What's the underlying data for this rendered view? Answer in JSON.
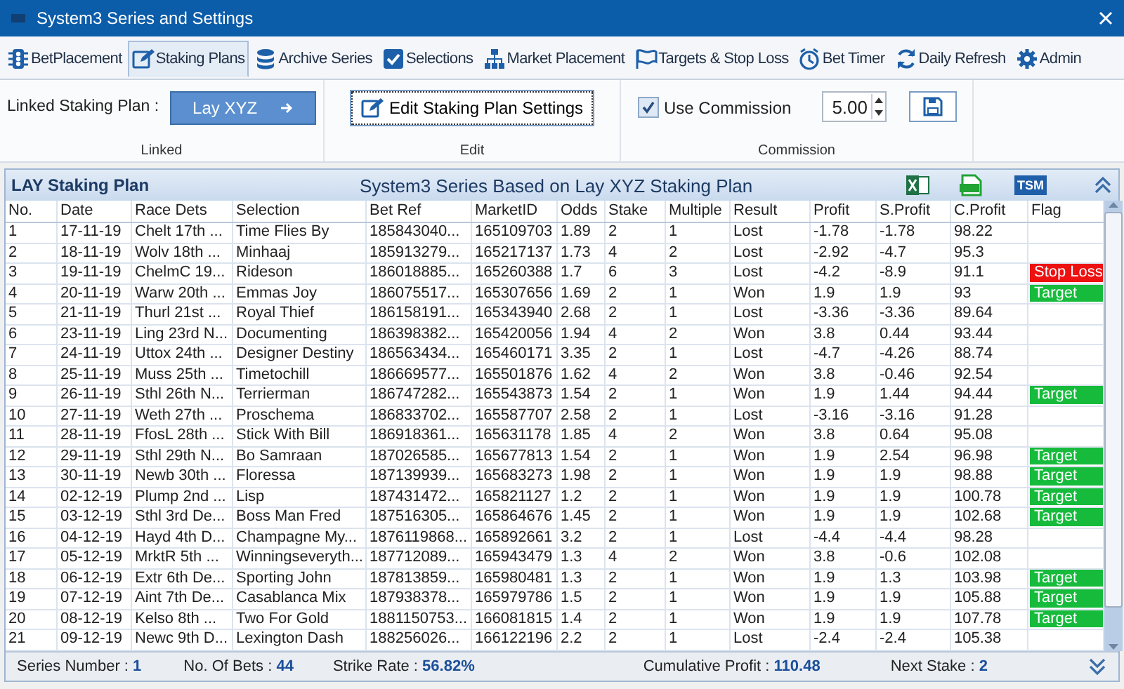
{
  "window": {
    "title": "System3 Series and Settings"
  },
  "tabs": [
    {
      "label": "BetPlacement",
      "selected": false
    },
    {
      "label": "Staking Plans",
      "selected": true
    },
    {
      "label": "Archive Series",
      "selected": false
    },
    {
      "label": "Selections",
      "selected": false
    },
    {
      "label": "Market Placement",
      "selected": false
    },
    {
      "label": "Targets & Stop Loss",
      "selected": false
    },
    {
      "label": "Bet Timer",
      "selected": false
    },
    {
      "label": "Daily Refresh",
      "selected": false
    },
    {
      "label": "Admin",
      "selected": false
    }
  ],
  "ribbon": {
    "linked": {
      "label": "Linked Staking Plan :",
      "button": "Lay XYZ",
      "group": "Linked"
    },
    "edit": {
      "button": "Edit Staking Plan Settings",
      "group": "Edit"
    },
    "commission": {
      "label": "Use Commission",
      "checked": true,
      "value": "5.00",
      "group": "Commission"
    }
  },
  "panel": {
    "title": "LAY Staking Plan",
    "subtitle": "System3 Series Based on Lay XYZ Staking Plan",
    "tsm": "TSM"
  },
  "table": {
    "columns": [
      "No.",
      "Date",
      "Race Dets",
      "Selection",
      "Bet Ref",
      "MarketID",
      "Odds",
      "Stake",
      "Multiple",
      "Result",
      "Profit",
      "S.Profit",
      "C.Profit",
      "Flag"
    ],
    "rows": [
      {
        "cells": [
          "1",
          "17-11-19",
          "Chelt 17th ...",
          "Time Flies By",
          "185843040...",
          "165109703",
          "1.89",
          "2",
          "1",
          "Lost",
          "-1.78",
          "-1.78",
          "98.22"
        ]
      },
      {
        "cells": [
          "2",
          "18-11-19",
          "Wolv 18th ...",
          "Minhaaj",
          "185913279...",
          "165217137",
          "1.73",
          "4",
          "2",
          "Lost",
          "-2.92",
          "-4.7",
          "95.3"
        ]
      },
      {
        "cells": [
          "3",
          "19-11-19",
          "ChelmC 19...",
          "Rideson",
          "186018885...",
          "165260388",
          "1.7",
          "6",
          "3",
          "Lost",
          "-4.2",
          "-8.9",
          "91.1"
        ],
        "flag": {
          "text": "Stop Loss",
          "kind": "stop_loss"
        }
      },
      {
        "cells": [
          "4",
          "20-11-19",
          "Warw 20th ...",
          "Emmas Joy",
          "186075517...",
          "165307656",
          "1.69",
          "2",
          "1",
          "Won",
          "1.9",
          "1.9",
          "93"
        ],
        "flag": {
          "text": "Target",
          "kind": "target"
        }
      },
      {
        "cells": [
          "5",
          "21-11-19",
          "Thurl 21st ...",
          "Royal Thief",
          "186158191...",
          "165343940",
          "2.68",
          "2",
          "1",
          "Lost",
          "-3.36",
          "-3.36",
          "89.64"
        ]
      },
      {
        "cells": [
          "6",
          "23-11-19",
          "Ling 23rd N...",
          "Documenting",
          "186398382...",
          "165420056",
          "1.94",
          "4",
          "2",
          "Won",
          "3.8",
          "0.44",
          "93.44"
        ]
      },
      {
        "cells": [
          "7",
          "24-11-19",
          "Uttox 24th ...",
          "Designer Destiny",
          "186563434...",
          "165460171",
          "3.35",
          "2",
          "1",
          "Lost",
          "-4.7",
          "-4.26",
          "88.74"
        ]
      },
      {
        "cells": [
          "8",
          "25-11-19",
          "Muss 25th ...",
          "Timetochill",
          "186669577...",
          "165501876",
          "1.62",
          "4",
          "2",
          "Won",
          "3.8",
          "-0.46",
          "92.54"
        ]
      },
      {
        "cells": [
          "9",
          "26-11-19",
          "Sthl 26th N...",
          "Terrierman",
          "186747282...",
          "165543873",
          "1.54",
          "2",
          "1",
          "Won",
          "1.9",
          "1.44",
          "94.44"
        ],
        "flag": {
          "text": "Target",
          "kind": "target"
        }
      },
      {
        "cells": [
          "10",
          "27-11-19",
          "Weth 27th ...",
          "Proschema",
          "186833702...",
          "165587707",
          "2.58",
          "2",
          "1",
          "Lost",
          "-3.16",
          "-3.16",
          "91.28"
        ]
      },
      {
        "cells": [
          "11",
          "28-11-19",
          "FfosL 28th ...",
          "Stick With Bill",
          "186918361...",
          "165631178",
          "1.85",
          "4",
          "2",
          "Won",
          "3.8",
          "0.64",
          "95.08"
        ]
      },
      {
        "cells": [
          "12",
          "29-11-19",
          "Sthl 29th N...",
          "Bo Samraan",
          "187026585...",
          "165677813",
          "1.54",
          "2",
          "1",
          "Won",
          "1.9",
          "2.54",
          "96.98"
        ],
        "flag": {
          "text": "Target",
          "kind": "target"
        }
      },
      {
        "cells": [
          "13",
          "30-11-19",
          "Newb 30th ...",
          "Floressa",
          "187139939...",
          "165683273",
          "1.98",
          "2",
          "1",
          "Won",
          "1.9",
          "1.9",
          "98.88"
        ],
        "flag": {
          "text": "Target",
          "kind": "target"
        }
      },
      {
        "cells": [
          "14",
          "02-12-19",
          "Plump 2nd ...",
          "Lisp",
          "187431472...",
          "165821127",
          "1.2",
          "2",
          "1",
          "Won",
          "1.9",
          "1.9",
          "100.78"
        ],
        "flag": {
          "text": "Target",
          "kind": "target"
        }
      },
      {
        "cells": [
          "15",
          "03-12-19",
          "Sthl 3rd De...",
          "Boss Man Fred",
          "187516305...",
          "165864676",
          "1.45",
          "2",
          "1",
          "Won",
          "1.9",
          "1.9",
          "102.68"
        ],
        "flag": {
          "text": "Target",
          "kind": "target"
        }
      },
      {
        "cells": [
          "16",
          "04-12-19",
          "Hayd 4th D...",
          "Champagne My...",
          "1876119868...",
          "165892661",
          "3.2",
          "2",
          "1",
          "Lost",
          "-4.4",
          "-4.4",
          "98.28"
        ]
      },
      {
        "cells": [
          "17",
          "05-12-19",
          "MrktR 5th ...",
          "Winningseveryth...",
          "187712089...",
          "165943479",
          "1.3",
          "4",
          "2",
          "Won",
          "3.8",
          "-0.6",
          "102.08"
        ]
      },
      {
        "cells": [
          "18",
          "06-12-19",
          "Extr 6th De...",
          "Sporting John",
          "187813859...",
          "165980481",
          "1.3",
          "2",
          "1",
          "Won",
          "1.9",
          "1.3",
          "103.98"
        ],
        "flag": {
          "text": "Target",
          "kind": "target"
        }
      },
      {
        "cells": [
          "19",
          "07-12-19",
          "Aint 7th De...",
          "Casablanca Mix",
          "187938378...",
          "165979786",
          "1.5",
          "2",
          "1",
          "Won",
          "1.9",
          "1.9",
          "105.88"
        ],
        "flag": {
          "text": "Target",
          "kind": "target"
        }
      },
      {
        "cells": [
          "20",
          "08-12-19",
          "Kelso 8th ...",
          "Two For Gold",
          "1881150753...",
          "166081815",
          "1.4",
          "2",
          "1",
          "Won",
          "1.9",
          "1.9",
          "107.78"
        ],
        "flag": {
          "text": "Target",
          "kind": "target"
        }
      },
      {
        "cells": [
          "21",
          "09-12-19",
          "Newc 9th D...",
          "Lexington Dash",
          "188256026...",
          "166122196",
          "2.2",
          "2",
          "1",
          "Lost",
          "-2.4",
          "-2.4",
          "105.38"
        ]
      }
    ]
  },
  "status_bar": [
    {
      "label": "Series Number :",
      "value": "1"
    },
    {
      "label": "No. Of Bets :",
      "value": "44"
    },
    {
      "label": "Strike Rate :",
      "value": "56.82%"
    },
    {
      "label": "Cumulative Profit :",
      "value": "110.48"
    },
    {
      "label": "Next Stake :",
      "value": "2"
    }
  ]
}
